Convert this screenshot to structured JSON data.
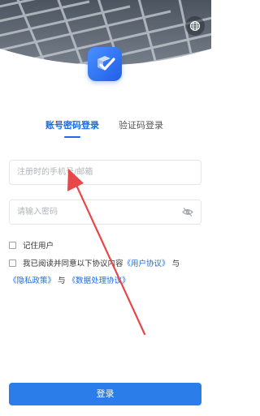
{
  "tabs": {
    "account_login": "账号密码登录",
    "code_login": "验证码登录"
  },
  "form": {
    "phone_placeholder": "注册时的手机号/邮箱",
    "password_placeholder": "请输入密码"
  },
  "options": {
    "remember_label": "记住用户",
    "agree_prefix": "我已阅读并同意以下协议内容",
    "user_agreement": "《用户协议》",
    "and": "与",
    "privacy_policy": "《隐私政策》",
    "data_agreement": "《数据处理协议》"
  },
  "actions": {
    "login_label": "登录"
  },
  "icons": {
    "language": "globe-icon",
    "app_logo": "checkmark-logo-icon",
    "password_visibility": "eye-off-icon"
  },
  "colors": {
    "accent": "#1d6ae5",
    "button": "#2b7de9",
    "annotation_arrow": "#e8474a"
  }
}
